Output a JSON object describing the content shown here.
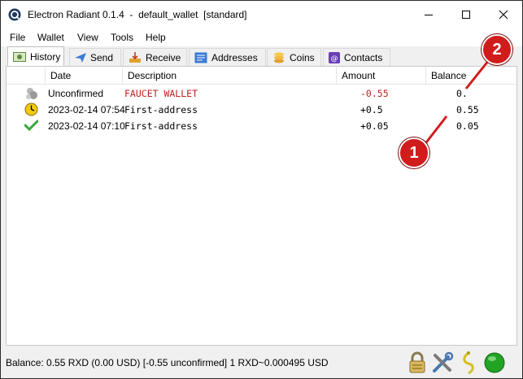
{
  "window": {
    "title": "Electron Radiant 0.1.4  -  default_wallet  [standard]"
  },
  "menu": {
    "items": [
      {
        "label": "File"
      },
      {
        "label": "Wallet"
      },
      {
        "label": "View"
      },
      {
        "label": "Tools"
      },
      {
        "label": "Help"
      }
    ]
  },
  "tabs": [
    {
      "label": "History",
      "active": true
    },
    {
      "label": "Send"
    },
    {
      "label": "Receive"
    },
    {
      "label": "Addresses"
    },
    {
      "label": "Coins"
    },
    {
      "label": "Contacts"
    }
  ],
  "history": {
    "columns": [
      "Date",
      "Description",
      "Amount",
      "Balance"
    ],
    "rows": [
      {
        "icon": "unconfirmed-icon",
        "date": "Unconfirmed",
        "description": "FAUCET WALLET",
        "amount": "-0.55",
        "balance": "0.",
        "negative": true
      },
      {
        "icon": "clock-icon",
        "date": "2023-02-14 07:54",
        "description": "First-address",
        "amount": "+0.5",
        "balance": "0.55",
        "negative": false
      },
      {
        "icon": "checkmark-icon",
        "date": "2023-02-14 07:10",
        "description": "First-address",
        "amount": "+0.05",
        "balance": "0.05",
        "negative": false
      }
    ]
  },
  "status": {
    "text": "Balance: 0.55 RXD (0.00 USD) [-0.55 unconfirmed] 1 RXD~0.000495 USD"
  },
  "callouts": [
    "1",
    "2"
  ],
  "colors": {
    "negative": "#c02020",
    "callout": "#d11c1c",
    "online": "#22a322"
  }
}
